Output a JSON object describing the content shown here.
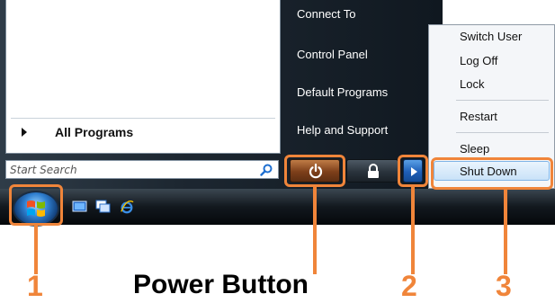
{
  "start_menu": {
    "all_programs": "All Programs",
    "search_placeholder": "Start Search",
    "right_items": [
      "Connect To",
      "Control Panel",
      "Default Programs",
      "Help and Support"
    ]
  },
  "power_popup": {
    "items": [
      "Switch User",
      "Log Off",
      "Lock",
      "Restart",
      "Sleep",
      "Shut Down"
    ],
    "highlighted": "Shut Down"
  },
  "annotations": {
    "callout_1": "1",
    "callout_2": "2",
    "callout_3": "3",
    "power_button_label": "Power Button",
    "highlight_color": "#f0853a"
  },
  "icons": [
    "search-icon",
    "power-icon",
    "lock-icon",
    "play-arrow-icon",
    "windows-start-icon",
    "show-desktop-icon",
    "switch-windows-icon",
    "internet-explorer-icon"
  ]
}
